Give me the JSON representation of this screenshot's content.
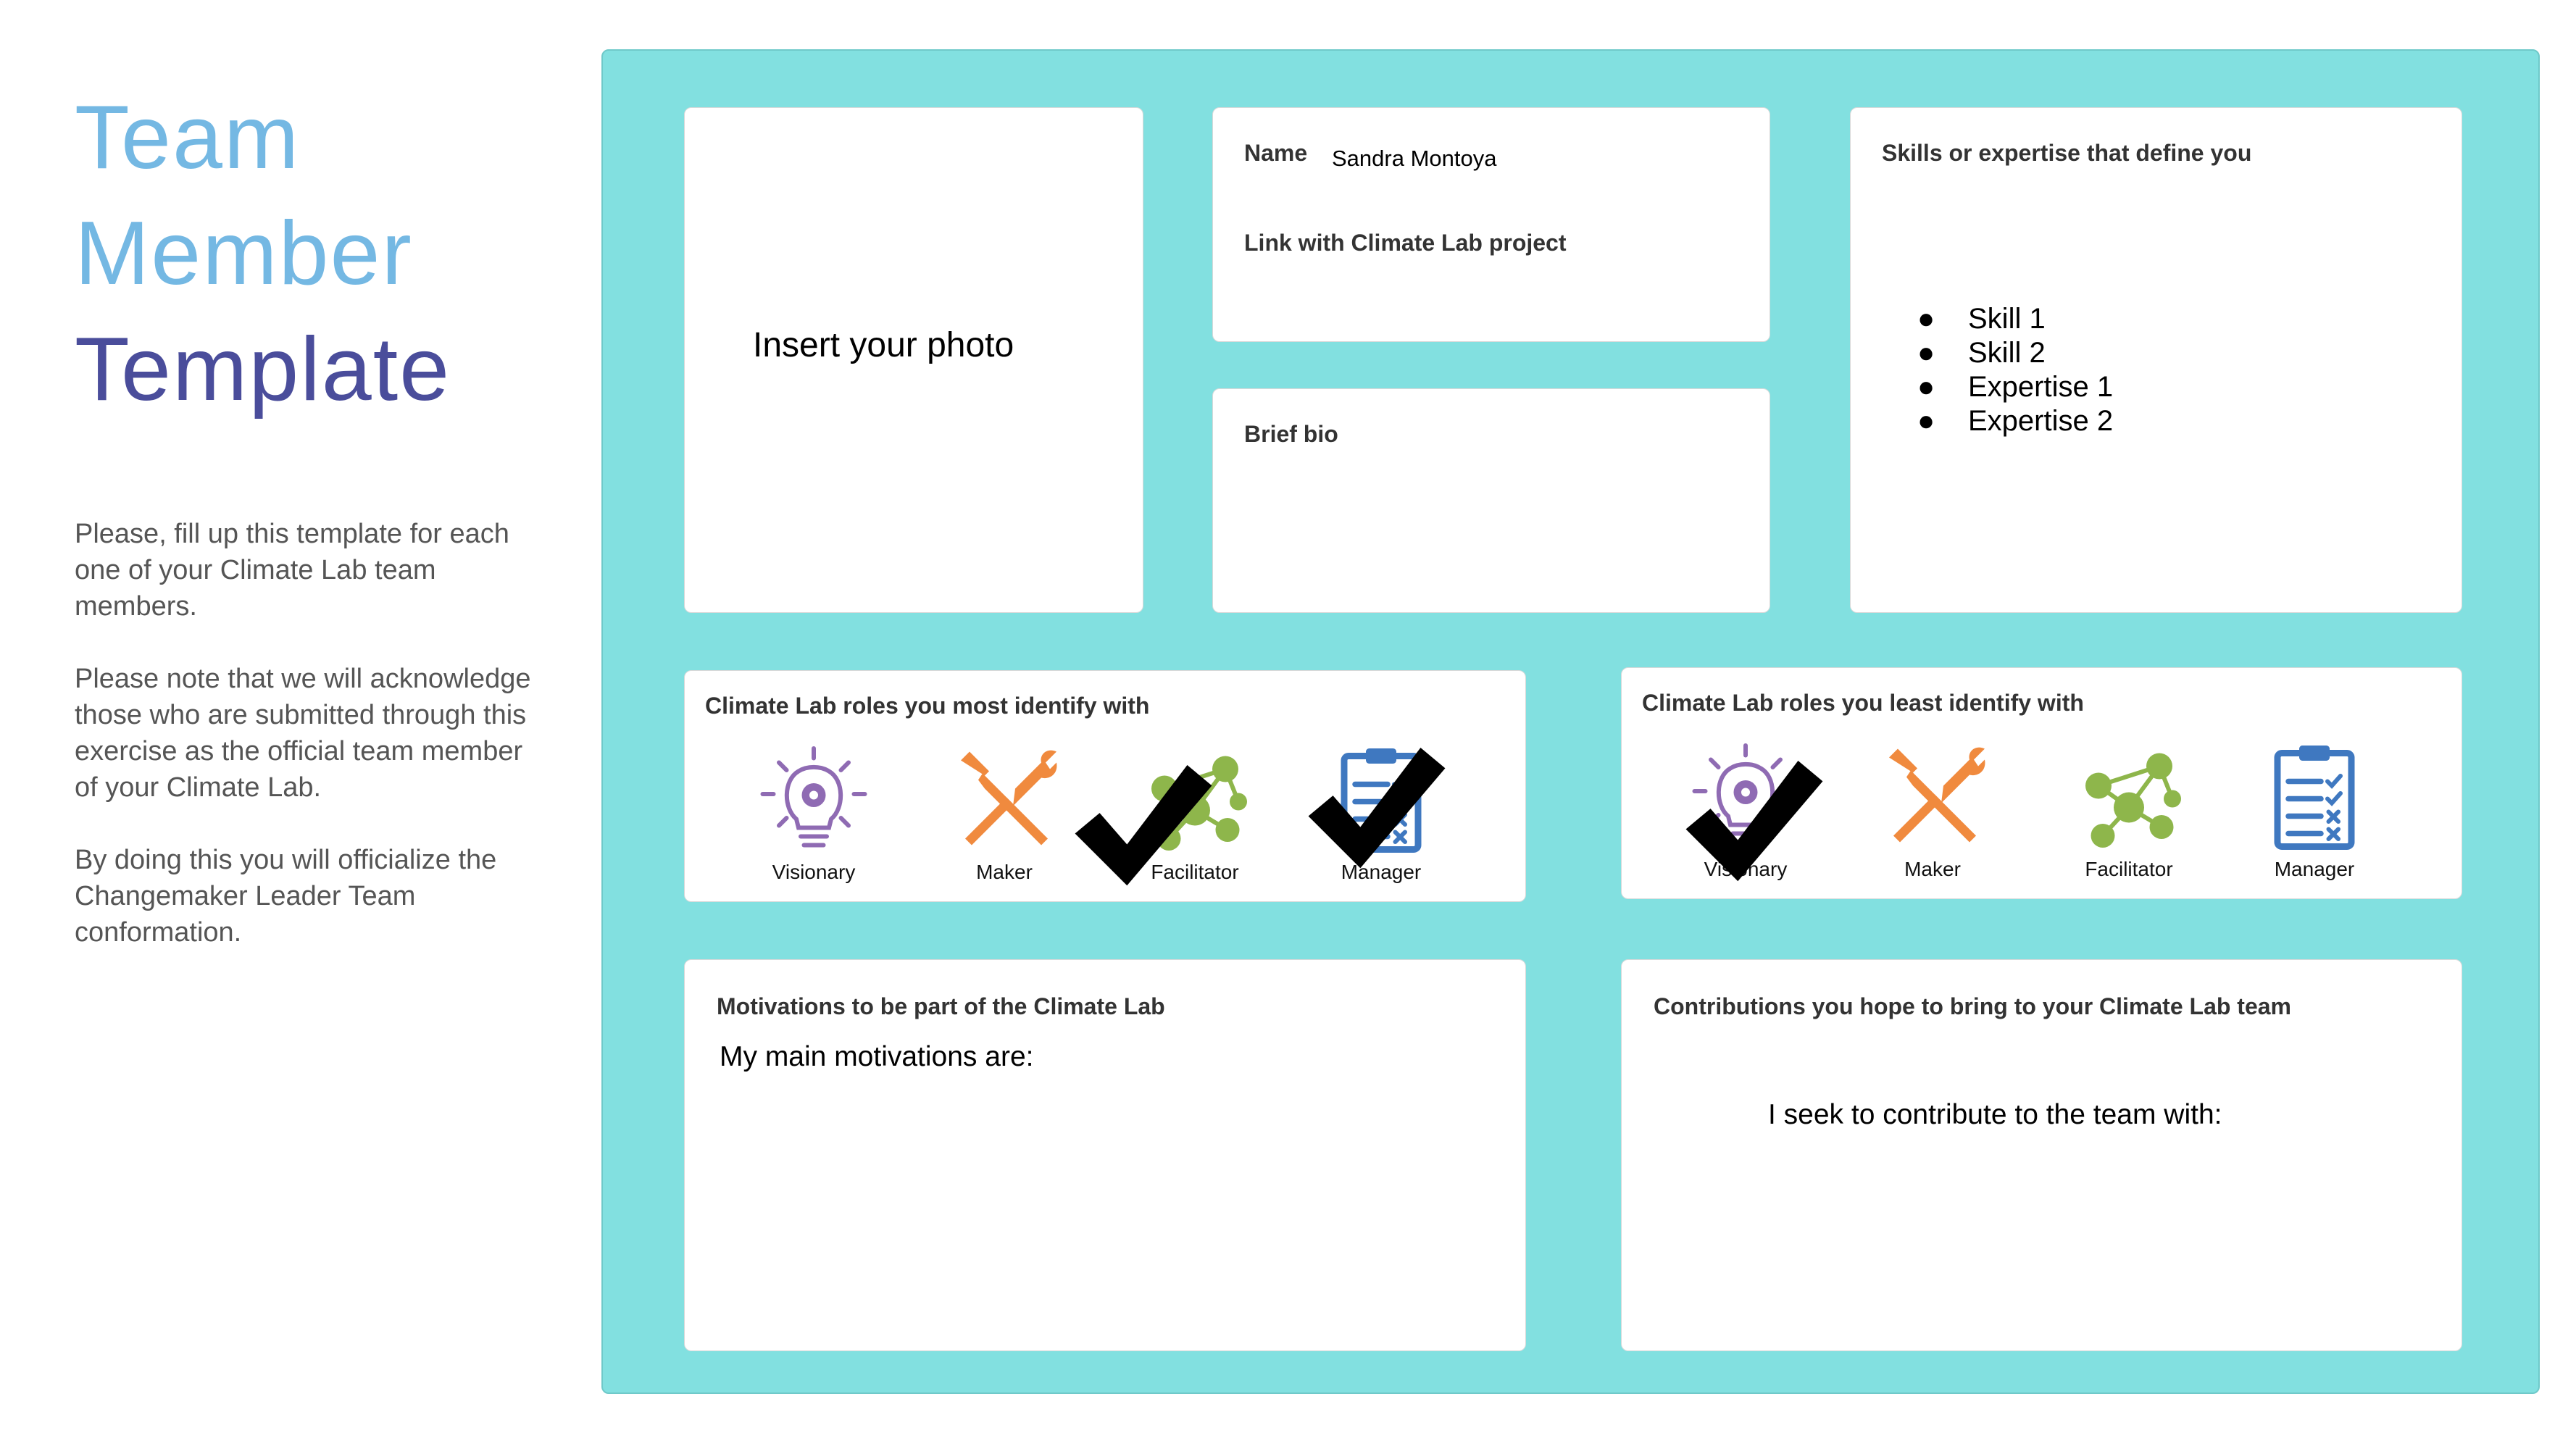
{
  "title": {
    "line1": "Team",
    "line2": "Member",
    "line3": "Template"
  },
  "colors": {
    "title_light": "#74b8e3",
    "title_dark": "#4a4d9b",
    "board": "#82e0e0",
    "visionary_icon": "#8f6bb3",
    "maker_icon": "#f08a3e",
    "facilitator_icon": "#8eb64b",
    "manager_icon": "#3f78c0"
  },
  "instructions": [
    "Please, fill up this template for each one of your Climate Lab team members.",
    "Please note that we will acknowledge those who are submitted through this exercise as the official team member of your Climate Lab.",
    "By doing this you will officialize the Changemaker Leader Team conformation."
  ],
  "photo": {
    "placeholder": "Insert your photo"
  },
  "identity": {
    "name_label": "Name",
    "name_value": "Sandra Montoya",
    "link_label": "Link with Climate Lab project"
  },
  "bio": {
    "label": "Brief bio"
  },
  "skills": {
    "label": "Skills or expertise that define you",
    "items": [
      "Skill 1",
      "Skill 2",
      "Expertise 1",
      "Expertise 2"
    ]
  },
  "roles_most": {
    "label": "Climate Lab roles you most identify with",
    "roles": [
      {
        "name": "Visionary",
        "icon": "lightbulb-gear-icon",
        "checked": false
      },
      {
        "name": "Maker",
        "icon": "wrench-screwdriver-icon",
        "checked": false
      },
      {
        "name": "Facilitator",
        "icon": "people-network-icon",
        "checked": true
      },
      {
        "name": "Manager",
        "icon": "clipboard-checklist-icon",
        "checked": true
      }
    ]
  },
  "roles_least": {
    "label": "Climate Lab roles you least identify with",
    "roles": [
      {
        "name": "Visionary",
        "icon": "lightbulb-gear-icon",
        "checked": true
      },
      {
        "name": "Maker",
        "icon": "wrench-screwdriver-icon",
        "checked": false
      },
      {
        "name": "Facilitator",
        "icon": "people-network-icon",
        "checked": false
      },
      {
        "name": "Manager",
        "icon": "clipboard-checklist-icon",
        "checked": false
      }
    ]
  },
  "motivations": {
    "label": "Motivations to be part of the Climate Lab",
    "text": "My main motivations are:"
  },
  "contributions": {
    "label": "Contributions you hope to bring to your Climate Lab team",
    "text": "I seek to contribute to the team with:"
  }
}
